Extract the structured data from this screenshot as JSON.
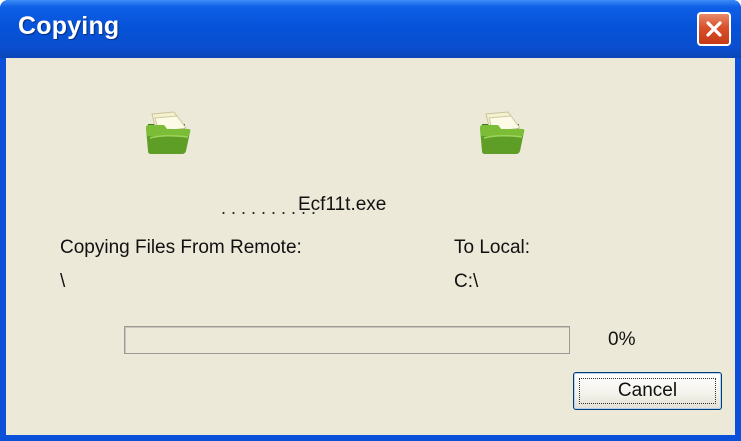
{
  "window": {
    "title": "Copying"
  },
  "icons": {
    "source": "folder-icon",
    "destination": "folder-icon",
    "close": "close-icon"
  },
  "transfer": {
    "dots": "..........",
    "file_name": "Ecf11t.exe",
    "from_label": "Copying Files From Remote:",
    "from_path": "\\",
    "to_label": "To Local:",
    "to_path": "C:\\"
  },
  "progress": {
    "value": 0,
    "text": "0%"
  },
  "buttons": {
    "cancel_label": "Cancel"
  },
  "colors": {
    "titlebar": "#0553d9",
    "client_background": "#ece9d8",
    "close_button": "#d9502b",
    "folder": "#4f8a1e"
  }
}
